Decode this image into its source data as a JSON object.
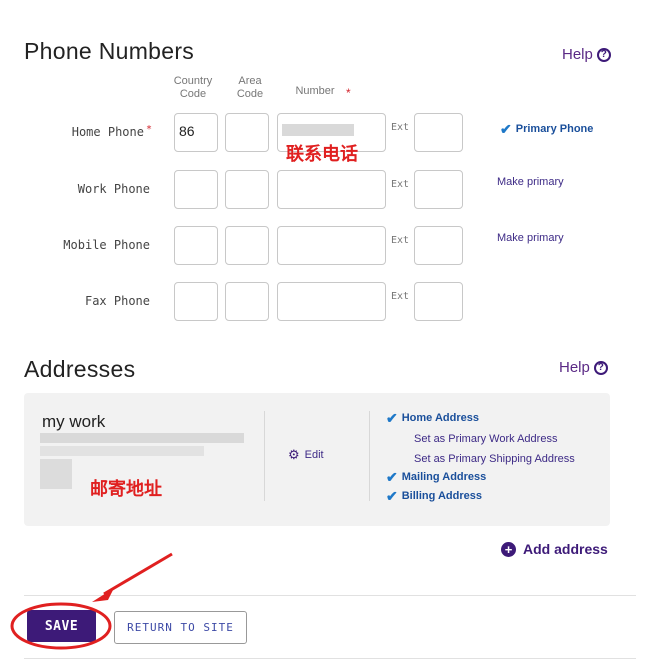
{
  "phone": {
    "title": "Phone Numbers",
    "help": "Help",
    "col_country": "Country Code",
    "col_area": "Area Code",
    "col_number": "Number",
    "required_mark": "*",
    "ext": "Ext",
    "rows": [
      {
        "label": "Home Phone",
        "required": "*",
        "country": "86",
        "status": "Primary Phone"
      },
      {
        "label": "Work Phone",
        "country": "",
        "status": "Make primary"
      },
      {
        "label": "Mobile Phone",
        "country": "",
        "status": "Make primary"
      },
      {
        "label": "Fax Phone",
        "country": "",
        "status": ""
      }
    ],
    "annotation": "联系电话"
  },
  "addresses": {
    "title": "Addresses",
    "help": "Help",
    "card": {
      "name": "my work",
      "edit": "Edit",
      "annotation": "邮寄地址",
      "options": [
        {
          "label": "Home Address",
          "checked": true
        },
        {
          "label": "Set as Primary Work Address",
          "checked": false
        },
        {
          "label": "Set as Primary Shipping Address",
          "checked": false
        },
        {
          "label": "Mailing Address",
          "checked": true
        },
        {
          "label": "Billing Address",
          "checked": true
        }
      ]
    },
    "add": "Add address"
  },
  "actions": {
    "save": "SAVE",
    "return": "RETURN TO SITE"
  },
  "colors": {
    "accent": "#3d1a78",
    "annotation_red": "#e02020",
    "check_blue": "#1e78c8"
  }
}
